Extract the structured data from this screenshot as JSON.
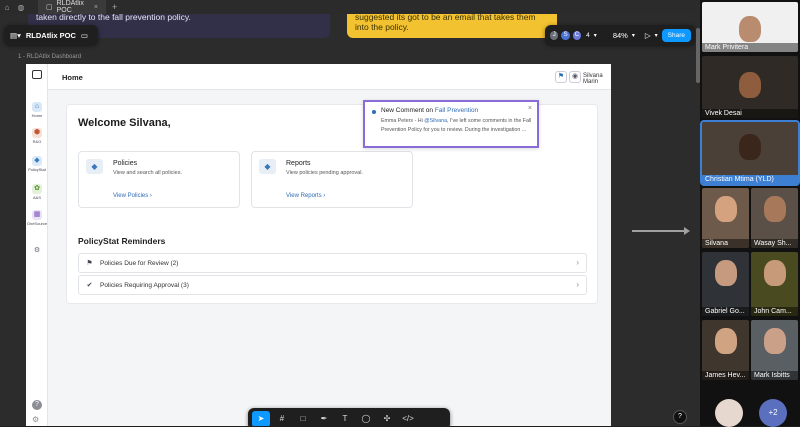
{
  "browser": {
    "tab_title": "RLDAtlix POC"
  },
  "stickies": {
    "left": "taken directly to the fall prevention policy.",
    "right": "suggested its got to be an email that takes them into the policy."
  },
  "figma": {
    "file_name": "RLDAtlix POC",
    "avatars": [
      "J",
      "S",
      "C"
    ],
    "avatar_extra": "4",
    "zoom": "84%",
    "share_label": "Share",
    "frame_label": "1 - RLDAtlix Dashboard",
    "help": "?"
  },
  "app": {
    "page_title": "Home",
    "user_name": "Silvana Marin",
    "nav": [
      {
        "label": "Home"
      },
      {
        "label": "R&G"
      },
      {
        "label": "PolicyStat"
      },
      {
        "label": "A&S"
      },
      {
        "label": "OneSource"
      }
    ],
    "welcome": "Welcome Silvana,",
    "cards": [
      {
        "title": "Policies",
        "desc": "View and search all policies.",
        "link": "View Policies  ›"
      },
      {
        "title": "Reports",
        "desc": "View policies pending approval.",
        "link": "View Reports  ›"
      }
    ],
    "reminders_title": "PolicyStat Reminders",
    "reminders": [
      {
        "label": "Policies Due for Review (2)"
      },
      {
        "label": "Policies Requiring Approval (3)"
      }
    ],
    "notification": {
      "title_prefix": "New Comment on ",
      "title_link": "Fall Prevention",
      "body_1": "Emma Peters - Hi ",
      "body_mention": "@Silvana",
      "body_2": ", I've left some comments in the Fall Prevention Policy for you to review. During the investigation ..."
    }
  },
  "participants": [
    {
      "name": "Mark Privitera"
    },
    {
      "name": "Vivek Desai"
    },
    {
      "name": "Christian Mtima (YLD)"
    },
    {
      "name": "Silvana"
    },
    {
      "name": "Wasay Sh..."
    },
    {
      "name": "Gabriel Go..."
    },
    {
      "name": "John Cam..."
    },
    {
      "name": "James Hev..."
    },
    {
      "name": "Mark Isbitts"
    }
  ],
  "more_participants": "+2"
}
